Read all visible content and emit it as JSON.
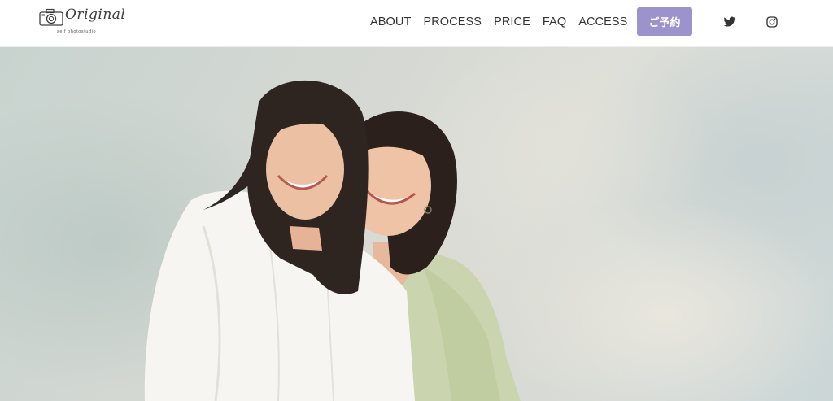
{
  "brand": {
    "name": "Original",
    "tagline": "self photostudio",
    "icon": "camera-icon"
  },
  "nav": {
    "items": [
      {
        "label": "ABOUT"
      },
      {
        "label": "PROCESS"
      },
      {
        "label": "PRICE"
      },
      {
        "label": "FAQ"
      },
      {
        "label": "ACCESS"
      }
    ]
  },
  "header": {
    "reserve_label": "ご予約",
    "social": [
      {
        "icon": "twitter-icon"
      },
      {
        "icon": "instagram-icon"
      }
    ]
  },
  "colors": {
    "accent": "#9c93cc",
    "nav_text": "#333333",
    "header_bg": "#ffffff"
  }
}
